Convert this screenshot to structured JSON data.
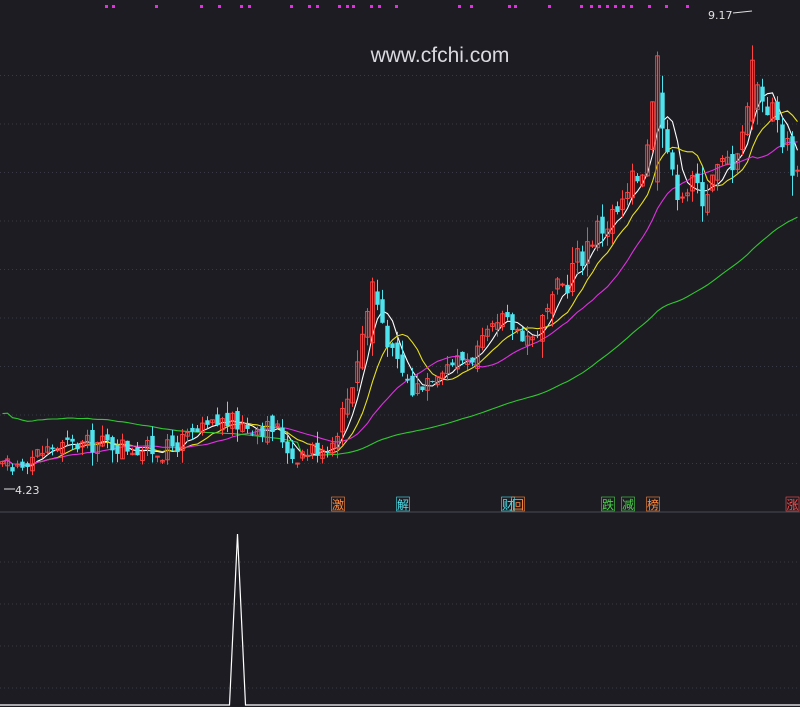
{
  "watermark": "www.cfchi.com",
  "annotations": {
    "high_label": "9.17",
    "low_label": "4.23"
  },
  "event_tags": [
    {
      "text": "激",
      "color": "#ff8a3d",
      "bar": 67
    },
    {
      "text": "解",
      "color": "#4fe3ee",
      "bar": 80
    },
    {
      "text": "财",
      "color": "#4fe3ee",
      "bar": 101
    },
    {
      "text": "回",
      "color": "#ff8a3d",
      "bar": 103
    },
    {
      "text": "跌",
      "color": "#49d649",
      "bar": 121
    },
    {
      "text": "减",
      "color": "#49d649",
      "bar": 125
    },
    {
      "text": "榜",
      "color": "#ff8a3d",
      "bar": 130
    },
    {
      "text": "涨",
      "color": "#ff5050",
      "bar": 159
    }
  ],
  "colors": {
    "background": "#1c1c22",
    "grid": "#3a3a44",
    "up": "#ff4444",
    "down": "#4fe3ee",
    "ma_fast": "#ffffff",
    "ma_mid": "#e8e020",
    "ma_slow": "#e030e0",
    "ma_long": "#30c830",
    "top_marks": "#e030e0",
    "volume_line": "#ffffff"
  },
  "chart_data": {
    "type": "candlestick",
    "title": "",
    "price_range": [
      3.85,
      9.6
    ],
    "high": 9.17,
    "low": 4.23,
    "bars": 160,
    "key_points": [
      {
        "bar": 0,
        "close": 4.3
      },
      {
        "bar": 10,
        "close": 4.55
      },
      {
        "bar": 20,
        "close": 4.6
      },
      {
        "bar": 32,
        "close": 4.5
      },
      {
        "bar": 44,
        "close": 4.85
      },
      {
        "bar": 55,
        "close": 4.75
      },
      {
        "bar": 58,
        "close": 4.45
      },
      {
        "bar": 66,
        "close": 4.6
      },
      {
        "bar": 70,
        "close": 5.3
      },
      {
        "bar": 74,
        "close": 6.4
      },
      {
        "bar": 78,
        "close": 5.6
      },
      {
        "bar": 82,
        "close": 5.2
      },
      {
        "bar": 88,
        "close": 5.5
      },
      {
        "bar": 94,
        "close": 5.6
      },
      {
        "bar": 100,
        "close": 6.0
      },
      {
        "bar": 106,
        "close": 5.8
      },
      {
        "bar": 112,
        "close": 6.4
      },
      {
        "bar": 118,
        "close": 7.0
      },
      {
        "bar": 124,
        "close": 7.3
      },
      {
        "bar": 128,
        "close": 7.8
      },
      {
        "bar": 131,
        "close": 8.8
      },
      {
        "bar": 134,
        "close": 7.6
      },
      {
        "bar": 140,
        "close": 7.5
      },
      {
        "bar": 146,
        "close": 7.9
      },
      {
        "bar": 151,
        "close": 8.7
      },
      {
        "bar": 155,
        "close": 8.3
      },
      {
        "bar": 159,
        "close": 7.7
      }
    ],
    "moving_averages": [
      "fast",
      "mid",
      "slow",
      "long"
    ],
    "indicator_panel": {
      "type": "line",
      "spike_bar": 47,
      "spike_value": 1.0,
      "baseline": 0
    }
  }
}
